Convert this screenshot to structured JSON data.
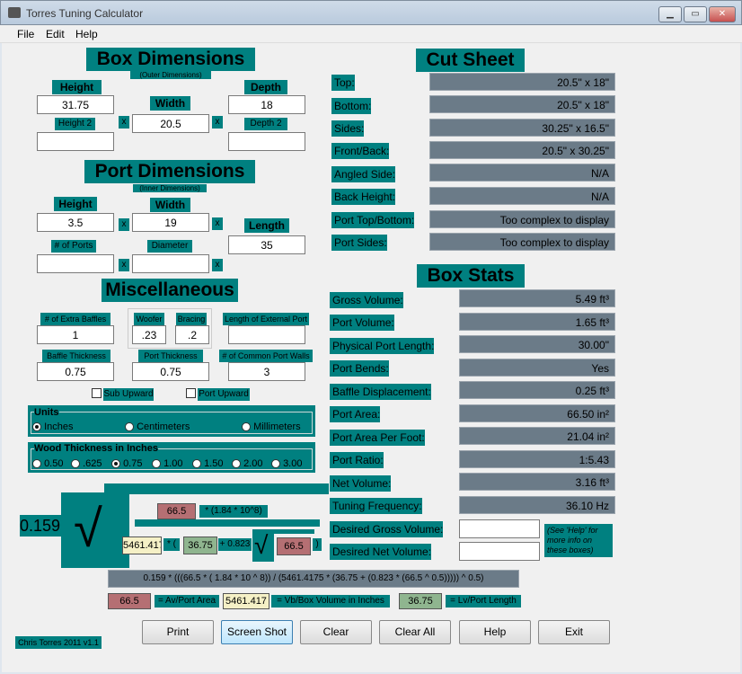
{
  "window": {
    "title": "Torres Tuning Calculator"
  },
  "menu": {
    "file": "File",
    "edit": "Edit",
    "help": "Help"
  },
  "box": {
    "title": "Box Dimensions",
    "subtitle": "(Outer Dimensions)",
    "height_label": "Height",
    "height": "31.75",
    "width_label": "Width",
    "width": "20.5",
    "depth_label": "Depth",
    "depth": "18",
    "height2_label": "Height 2",
    "height2": "",
    "depth2_label": "Depth 2",
    "depth2": "",
    "x": "x"
  },
  "port": {
    "title": "Port Dimensions",
    "subtitle": "(Inner Dimensions)",
    "height_label": "Height",
    "height": "3.5",
    "width_label": "Width",
    "width": "19",
    "length_label": "Length",
    "length": "35",
    "ports_label": "# of Ports",
    "ports": "",
    "diameter_label": "Diameter",
    "diameter": ""
  },
  "misc": {
    "title": "Miscellaneous",
    "baffles_label": "# of Extra Baffles",
    "baffles": "1",
    "woofer_label": "Woofer",
    "woofer": ".23",
    "bracing_label": "Bracing",
    "bracing": ".2",
    "ext_port_label": "Length of External Port",
    "ext_port": "",
    "baffle_thick_label": "Baffle Thickness",
    "baffle_thick": "0.75",
    "port_thick_label": "Port Thickness",
    "port_thick": "0.75",
    "common_walls_label": "# of Common Port Walls",
    "common_walls": "3",
    "sub_upward": "Sub Upward",
    "port_upward": "Port Upward"
  },
  "units": {
    "label": "Units",
    "inches": "Inches",
    "centimeters": "Centimeters",
    "millimeters": "Millimeters",
    "selected": "Inches"
  },
  "wood": {
    "label": "Wood Thickness in Inches",
    "options": [
      "0.50",
      ".625",
      "0.75",
      "1.00",
      "1.50",
      "2.00",
      "3.00"
    ],
    "selected": "0.75"
  },
  "formula": {
    "coef": "0.159",
    "area": "66.5",
    "exp": "* (1.84 * 10^8)",
    "vb": "5461.417",
    "paren": "* (",
    "lv": "36.75",
    "mult": "+ 0.823",
    "area2": "66.5",
    "close": ")",
    "full": "0.159 * (((66.5 * ( 1.84 * 10 ^ 8)) / (5461.4175 * (36.75 + (0.823 * (66.5 ^ 0.5))))) ^ 0.5)",
    "legend_area": "66.5",
    "legend_area_label": "= Av/Port Area",
    "legend_vb": "5461.417",
    "legend_vb_label": "= Vb/Box Volume in Inches",
    "legend_lv": "36.75",
    "legend_lv_label": "= Lv/Port Length"
  },
  "cut": {
    "title": "Cut Sheet",
    "rows": [
      {
        "label": "Top:",
        "value": "20.5\" x 18\""
      },
      {
        "label": "Bottom:",
        "value": "20.5\" x 18\""
      },
      {
        "label": "Sides:",
        "value": "30.25\" x 16.5\""
      },
      {
        "label": "Front/Back:",
        "value": "20.5\" x 30.25\""
      },
      {
        "label": "Angled Side:",
        "value": "N/A"
      },
      {
        "label": "Back Height:",
        "value": "N/A"
      },
      {
        "label": "Port Top/Bottom:",
        "value": "Too complex to display"
      },
      {
        "label": "Port Sides:",
        "value": "Too complex to display"
      }
    ]
  },
  "stats": {
    "title": "Box Stats",
    "rows": [
      {
        "label": "Gross Volume:",
        "value": "5.49 ft³"
      },
      {
        "label": "Port Volume:",
        "value": "1.65 ft³"
      },
      {
        "label": "Physical Port Length:",
        "value": "30.00\""
      },
      {
        "label": "Port Bends:",
        "value": "Yes"
      },
      {
        "label": "Baffle Displacement:",
        "value": "0.25 ft³"
      },
      {
        "label": "Port Area:",
        "value": "66.50 in²"
      },
      {
        "label": "Port Area Per Foot:",
        "value": "21.04 in²"
      },
      {
        "label": "Port Ratio:",
        "value": "1:5.43"
      },
      {
        "label": "Net Volume:",
        "value": "3.16 ft³"
      },
      {
        "label": "Tuning Frequency:",
        "value": "36.10 Hz"
      }
    ],
    "desired_gross_label": "Desired Gross Volume:",
    "desired_gross": "",
    "desired_net_label": "Desired Net Volume:",
    "desired_net": "",
    "note": "(See 'Help' for more info on these boxes)"
  },
  "buttons": {
    "print": "Print",
    "screenshot": "Screen Shot",
    "clear": "Clear",
    "clear_all": "Clear All",
    "help": "Help",
    "exit": "Exit"
  },
  "credit": "Chris Torres 2011 v1.1"
}
